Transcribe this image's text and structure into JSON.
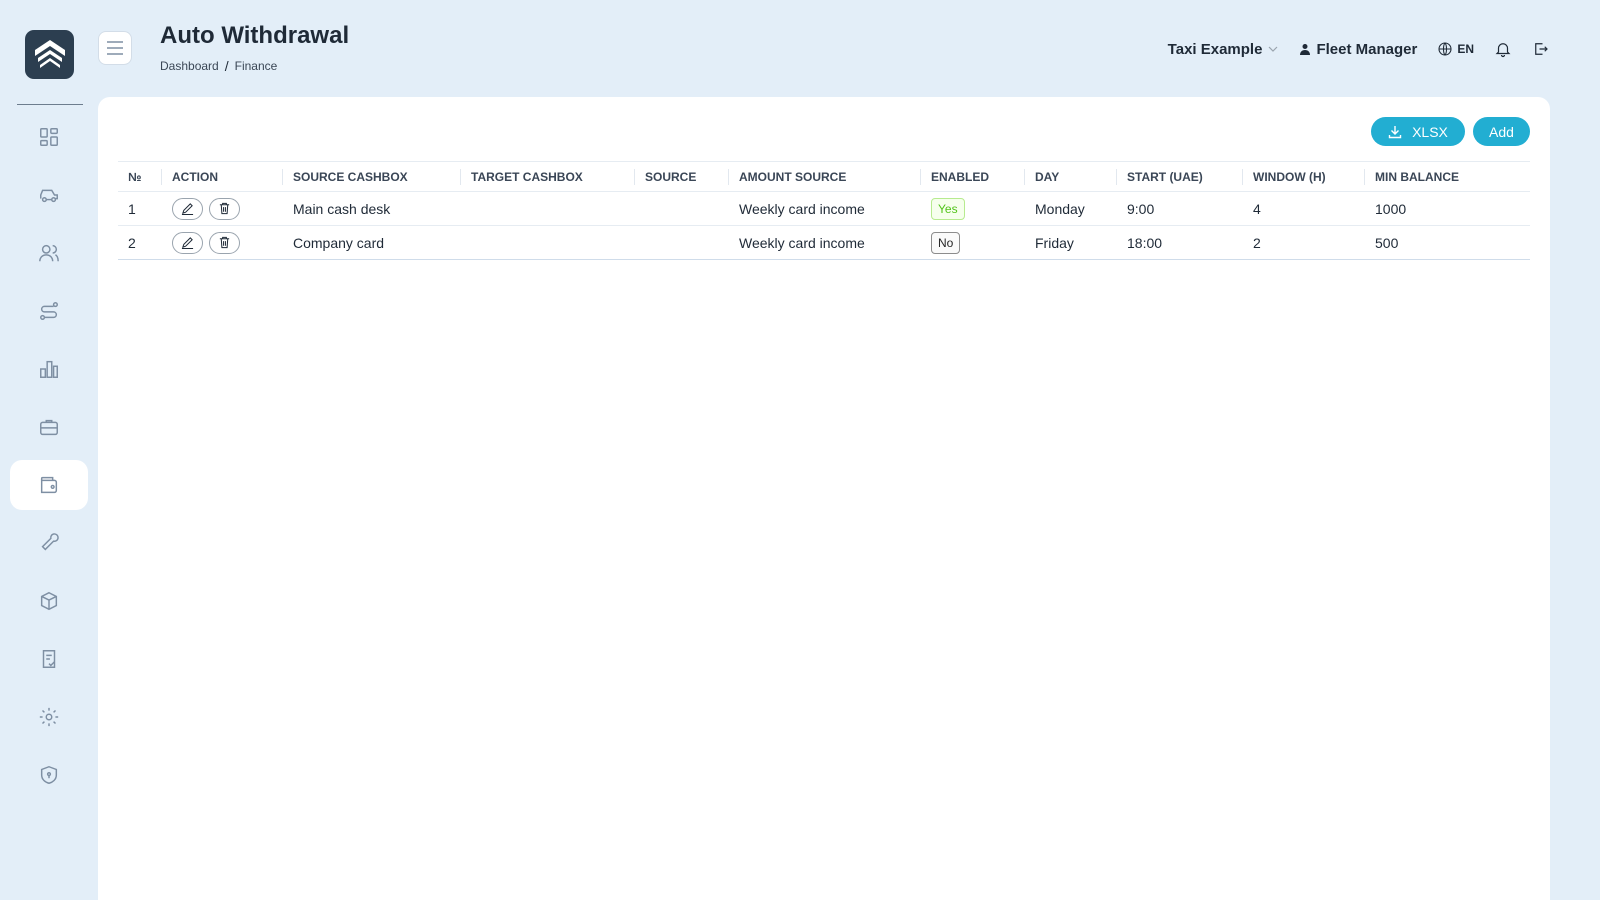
{
  "header": {
    "title": "Auto Withdrawal",
    "breadcrumb": [
      "Dashboard",
      "Finance"
    ],
    "breadcrumb_separator": "/",
    "company": "Taxi Example",
    "user": "Fleet Manager",
    "language": "EN"
  },
  "sidebar": {
    "items": [
      {
        "icon": "dashboard-icon"
      },
      {
        "icon": "car-icon"
      },
      {
        "icon": "users-icon"
      },
      {
        "icon": "route-icon"
      },
      {
        "icon": "chart-icon"
      },
      {
        "icon": "briefcase-icon"
      },
      {
        "icon": "wallet-icon",
        "active": true
      },
      {
        "icon": "wrench-icon"
      },
      {
        "icon": "package-icon"
      },
      {
        "icon": "clipboard-check-icon"
      },
      {
        "icon": "gear-icon"
      },
      {
        "icon": "shield-icon"
      }
    ]
  },
  "toolbar": {
    "xlsx_label": "XLSX",
    "add_label": "Add"
  },
  "table": {
    "columns": [
      "№",
      "ACTION",
      "SOURCE CASHBOX",
      "TARGET CASHBOX",
      "SOURCE",
      "AMOUNT SOURCE",
      "ENABLED",
      "DAY",
      "START (UAE)",
      "WINDOW (H)",
      "MIN BALANCE"
    ],
    "rows": [
      {
        "num": "1",
        "source_cashbox": "Main cash desk",
        "target_cashbox": "",
        "source": "",
        "amount_source": "Weekly card income",
        "enabled": "Yes",
        "day": "Monday",
        "start": "9:00",
        "window": "4",
        "min_balance": "1000"
      },
      {
        "num": "2",
        "source_cashbox": "Company card",
        "target_cashbox": "",
        "source": "",
        "amount_source": "Weekly card income",
        "enabled": "No",
        "day": "Friday",
        "start": "18:00",
        "window": "2",
        "min_balance": "500"
      }
    ]
  },
  "colors": {
    "background": "#e3eef8",
    "accent": "#22aed2",
    "enabled_yes": "#52c41a"
  }
}
